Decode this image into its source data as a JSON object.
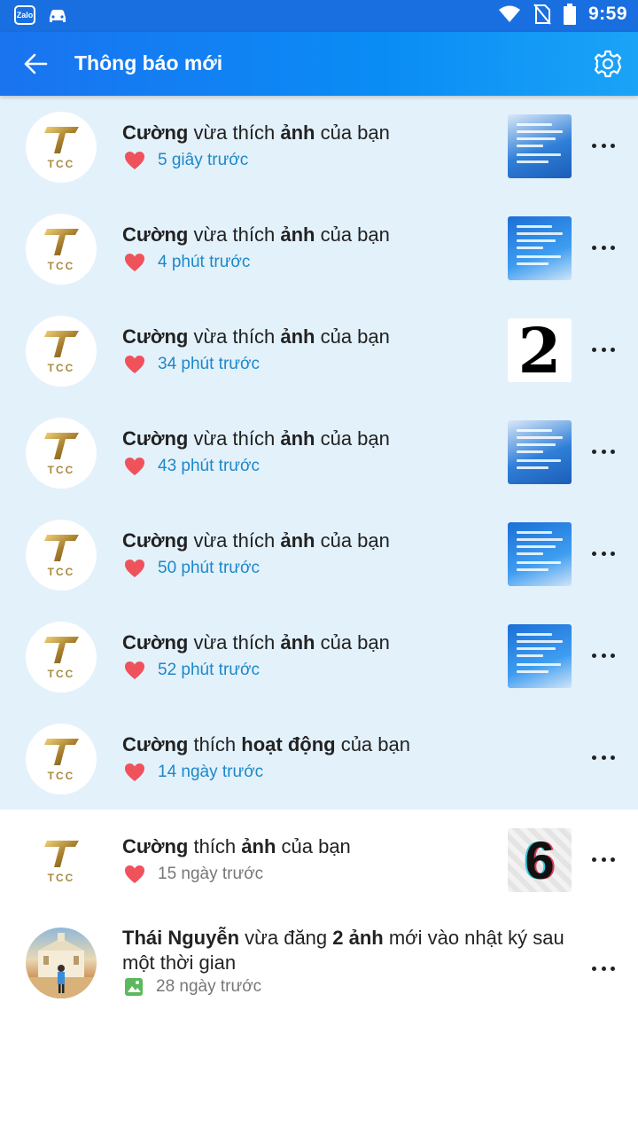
{
  "status_bar": {
    "clock": "9:59",
    "zalo_badge": "Zalo"
  },
  "header": {
    "title": "Thông báo mới"
  },
  "notifications": [
    {
      "actor": "Cường",
      "verb": " vừa thích ",
      "object": "ảnh",
      "tail": " của bạn",
      "time": "5 giây trước",
      "logo": "TCC"
    },
    {
      "actor": "Cường",
      "verb": " vừa thích ",
      "object": "ảnh",
      "tail": " của bạn",
      "time": "4 phút trước",
      "logo": "TCC"
    },
    {
      "actor": "Cường",
      "verb": " vừa thích ",
      "object": "ảnh",
      "tail": " của bạn",
      "time": "34 phút trước",
      "logo": "TCC",
      "thumb_text": "2"
    },
    {
      "actor": "Cường",
      "verb": " vừa thích ",
      "object": "ảnh",
      "tail": " của bạn",
      "time": "43 phút trước",
      "logo": "TCC"
    },
    {
      "actor": "Cường",
      "verb": " vừa thích ",
      "object": "ảnh",
      "tail": " của bạn",
      "time": "50 phút trước",
      "logo": "TCC"
    },
    {
      "actor": "Cường",
      "verb": " vừa thích ",
      "object": "ảnh",
      "tail": " của bạn",
      "time": "52 phút trước",
      "logo": "TCC"
    },
    {
      "actor": "Cường",
      "verb": " thích ",
      "object": "hoạt động",
      "tail": " của bạn",
      "time": "14 ngày trước",
      "logo": "TCC"
    },
    {
      "actor": "Cường",
      "verb": " thích ",
      "object": "ảnh",
      "tail": " của bạn",
      "time": "15 ngày trước",
      "logo": "TCC",
      "thumb_text": "6"
    },
    {
      "actor": "Thái Nguyễn",
      "verb": " vừa đăng ",
      "object": "2 ảnh",
      "tail": " mới vào nhật ký sau một thời gian",
      "time": "28 ngày trước"
    }
  ],
  "colors": {
    "accent": "#1a73f0",
    "unread_bg": "#e3f1fb",
    "heart": "#f0525c",
    "photo_icon": "#5cb85c"
  }
}
